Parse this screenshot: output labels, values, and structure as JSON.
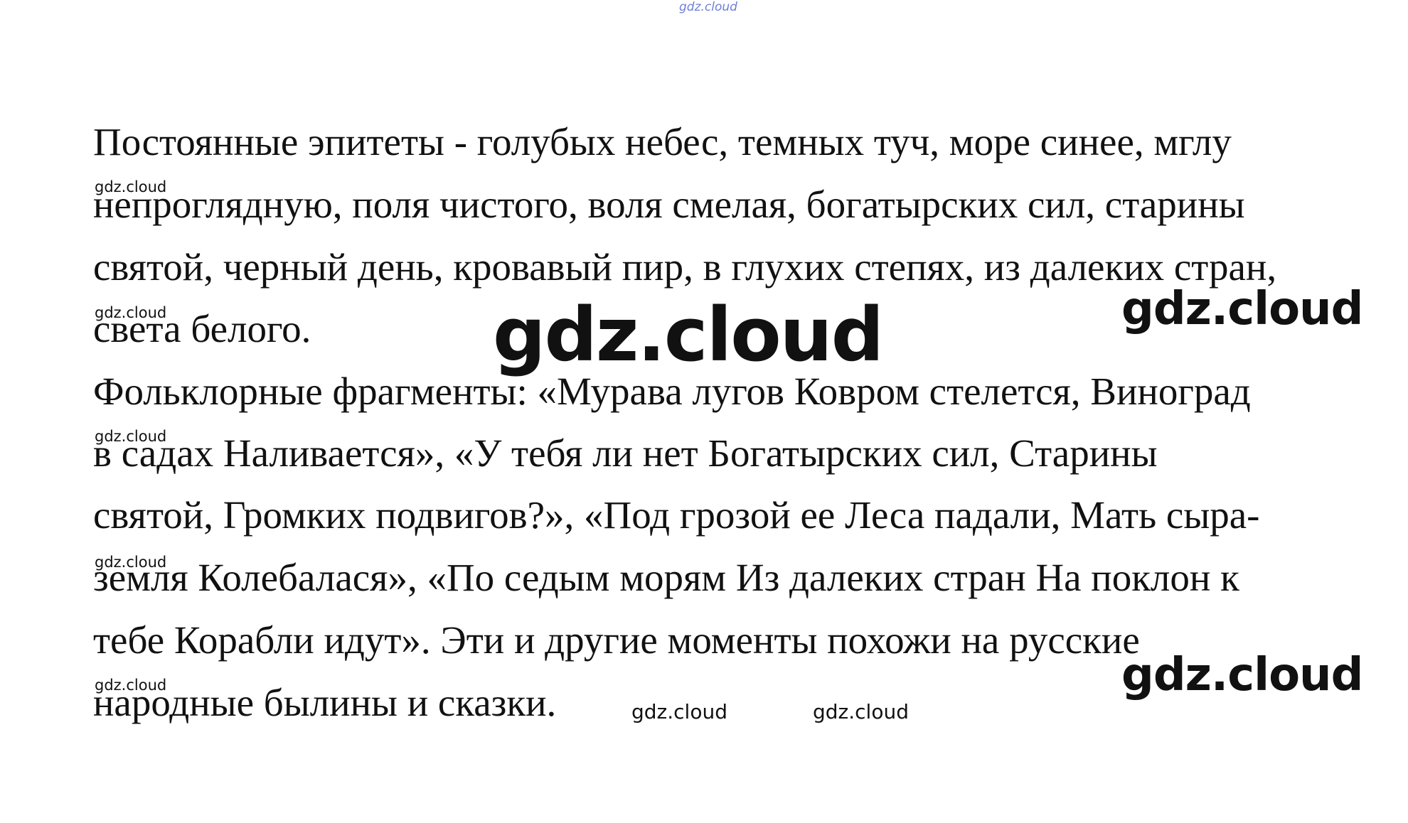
{
  "document": {
    "lines": [
      "Постоянные эпитеты - голубых небес, темных туч, море синее, мглу",
      "непроглядную, поля чистого, воля смелая, богатырских сил, старины",
      "святой, черный день, кровавый пир, в глухих степях, из далеких стран,",
      "света белого.",
      "Фольклорные фрагменты: «Мурава лугов Ковром стелется, Виноград",
      "в садах Наливается», «У тебя ли нет Богатырских сил, Старины",
      "святой, Громких подвигов?», «Под грозой ее Леса падали, Мать сыра-",
      "земля Колебалася», «По седым морям Из далеких стран На поклон к",
      "тебе Корабли идут». Эти и другие моменты похожи на русские",
      "народные былины и сказки."
    ]
  },
  "watermarks": {
    "text": "gdz.cloud",
    "top_color": "#6e7fd6"
  }
}
